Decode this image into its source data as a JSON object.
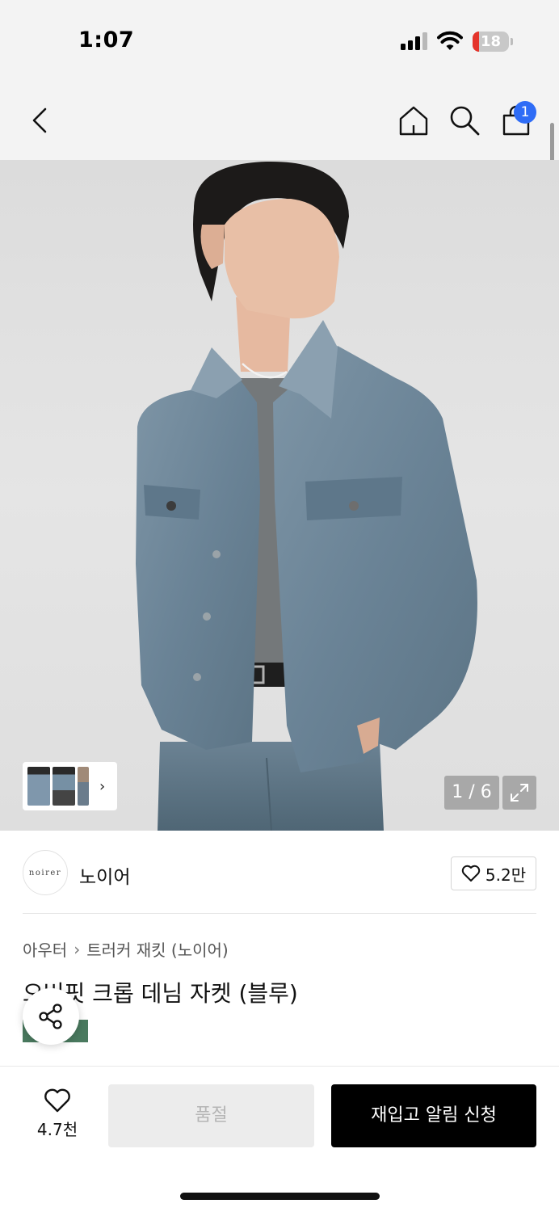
{
  "status_bar": {
    "time": "1:07",
    "battery_level": "18",
    "battery_color": "#e4342b"
  },
  "nav": {
    "back_icon": "chevron-left-icon",
    "home_icon": "home-icon",
    "search_icon": "search-icon",
    "cart_icon": "shopping-bag-icon",
    "cart_badge": "1",
    "badge_color": "#2e6cf6"
  },
  "gallery": {
    "counter": "1 / 6",
    "current": 1,
    "total": 6,
    "expand_icon": "expand-icon",
    "thumbnail_arrow": "›"
  },
  "brand": {
    "logo_text": "noirer",
    "name": "노이어",
    "likes": "5.2만"
  },
  "product": {
    "breadcrumb": [
      "아우터",
      "트러커 재킷 (노이어)"
    ],
    "breadcrumb_separator": "›",
    "title": "오버핏 크롭 데님 자켓 (블루)",
    "tag": "",
    "tag_color": "#4a7a5f"
  },
  "actions": {
    "wish_count": "4.7천",
    "soldout_label": "품절",
    "restock_label": "재입고 알림 신청"
  }
}
